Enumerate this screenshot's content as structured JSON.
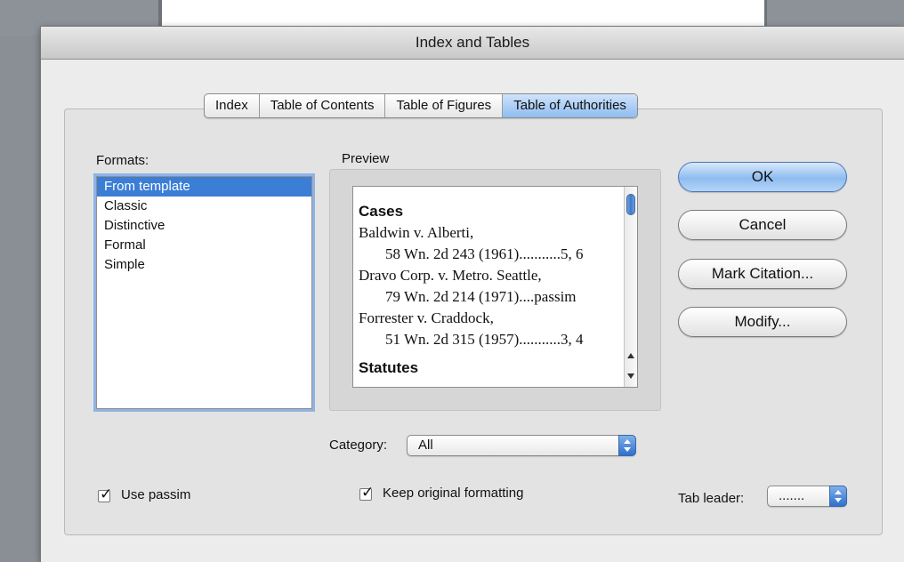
{
  "window": {
    "title": "Index and Tables"
  },
  "tabs": [
    {
      "label": "Index",
      "selected": false
    },
    {
      "label": "Table of Contents",
      "selected": false
    },
    {
      "label": "Table of Figures",
      "selected": false
    },
    {
      "label": "Table of Authorities",
      "selected": true
    }
  ],
  "formats": {
    "label": "Formats:",
    "items": [
      "From template",
      "Classic",
      "Distinctive",
      "Formal",
      "Simple"
    ],
    "selected": "From template"
  },
  "preview": {
    "label": "Preview",
    "heading_cases": "Cases",
    "lines": [
      "Baldwin v. Alberti,",
      "58 Wn. 2d 243 (1961)...........5, 6",
      "Dravo Corp. v. Metro. Seattle,",
      "79 Wn. 2d 214 (1971)....passim",
      "Forrester v. Craddock,",
      "51 Wn. 2d 315 (1957)...........3, 4"
    ],
    "heading_statutes": "Statutes"
  },
  "buttons": {
    "ok": "OK",
    "cancel": "Cancel",
    "mark_citation": "Mark Citation...",
    "modify": "Modify..."
  },
  "category": {
    "label": "Category:",
    "value": "All"
  },
  "options": {
    "use_passim": {
      "label": "Use passim",
      "checked": true
    },
    "keep_formatting": {
      "label": "Keep original formatting",
      "checked": true
    }
  },
  "tab_leader": {
    "label": "Tab leader:",
    "value": "......."
  },
  "colors": {
    "accent": "#3b7ed6",
    "default_button": "#8ebcf0",
    "selected_tab": "#8fbcf0"
  }
}
